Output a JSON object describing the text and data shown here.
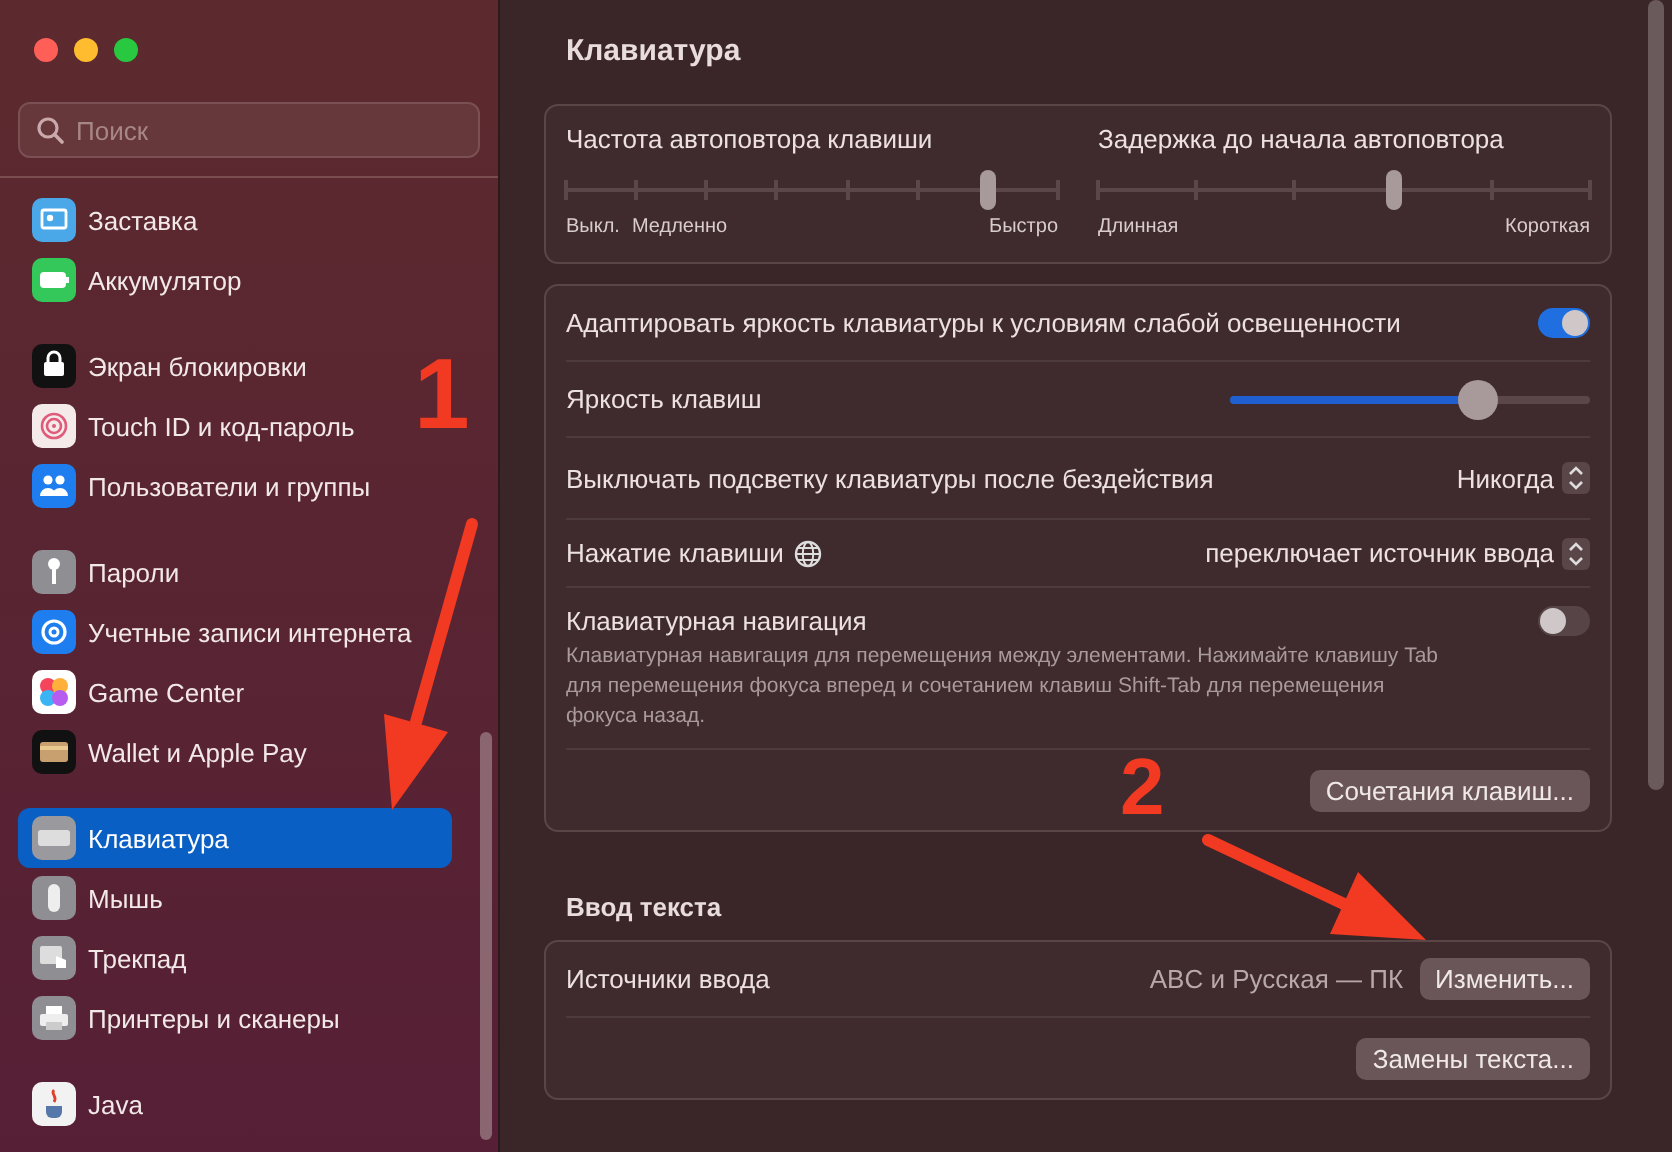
{
  "window": {
    "traffic_lights": [
      {
        "color": "#ff5f57"
      },
      {
        "color": "#febc2e"
      },
      {
        "color": "#28c840"
      }
    ]
  },
  "sidebar": {
    "search": {
      "placeholder": "Поиск"
    },
    "groups": [
      [
        {
          "label": "Заставка",
          "selected": false
        },
        {
          "label": "Аккумулятор",
          "selected": false
        }
      ],
      [
        {
          "label": "Экран блокировки",
          "selected": false
        },
        {
          "label": "Touch ID и код-пароль",
          "selected": false
        },
        {
          "label": "Пользователи и группы",
          "selected": false
        }
      ],
      [
        {
          "label": "Пароли",
          "selected": false
        },
        {
          "label": "Учетные записи интернета",
          "selected": false
        },
        {
          "label": "Game Center",
          "selected": false
        },
        {
          "label": "Wallet и Apple Pay",
          "selected": false
        }
      ],
      [
        {
          "label": "Клавиатура",
          "selected": true
        },
        {
          "label": "Мышь",
          "selected": false
        },
        {
          "label": "Трекпад",
          "selected": false
        },
        {
          "label": "Принтеры и сканеры",
          "selected": false
        }
      ],
      [
        {
          "label": "Java",
          "selected": false
        }
      ]
    ]
  },
  "content": {
    "title": "Клавиатура",
    "repeat_card": [
      {
        "label": "Частота автоповтора клавиши",
        "level": 0.857,
        "left": [
          "Выкл.",
          "Медленно"
        ],
        "right": "Быстро"
      },
      {
        "label": "Задержка до начала автоповтора",
        "level": 0.6,
        "left": [
          "Длинная"
        ],
        "right": "Короткая"
      }
    ],
    "settings": [
      {
        "kind": "toggle",
        "label": "Адаптировать яркость клавиатуры к условиям слабой освещенности",
        "on": true
      },
      {
        "kind": "slider",
        "label": "Яркость клавиш",
        "level": 0.69
      },
      {
        "kind": "popup",
        "label": "Выключать подсветку клавиатуры после бездействия",
        "value": "Никогда"
      },
      {
        "kind": "popup",
        "label": "Нажатие клавиши",
        "globe": true,
        "value": "переключает источник ввода"
      },
      {
        "kind": "toggle",
        "label": "Клавиатурная навигация",
        "on": false,
        "description": "Клавиатурная навигация для перемещения между элементами. Нажимайте клавишу Tab для перемещения фокуса вперед и сочетанием клавиш Shift-Tab для перемещения фокуса назад."
      },
      {
        "kind": "button",
        "button": "Сочетания клавиш..."
      }
    ],
    "text_input_heading": "Ввод текста",
    "text_input": [
      {
        "kind": "source",
        "label": "Источники ввода",
        "value": "ABC и Русская — ПК",
        "button": "Изменить..."
      },
      {
        "kind": "button",
        "button": "Замены текста..."
      }
    ]
  },
  "annotations": [
    {
      "label": "1"
    },
    {
      "label": "2"
    }
  ]
}
